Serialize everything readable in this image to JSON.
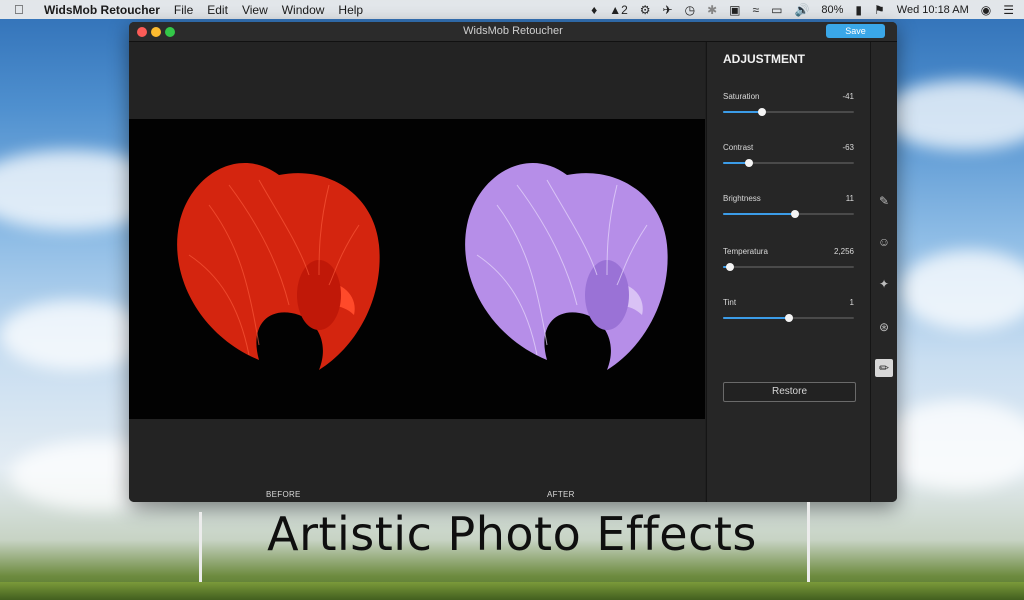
{
  "menubar": {
    "app_name": "WidsMob Retoucher",
    "menus": [
      "File",
      "Edit",
      "View",
      "Window",
      "Help"
    ],
    "status": {
      "badge_count": "2",
      "battery": "80%",
      "datetime": "Wed 10:18 AM"
    }
  },
  "window": {
    "title": "WidsMob Retoucher",
    "save_label": "Save",
    "before_label": "BEFORE",
    "after_label": "AFTER"
  },
  "panel": {
    "title": "ADJUSTMENT",
    "sliders": [
      {
        "name": "Saturation",
        "value": "-41",
        "level": 0.3
      },
      {
        "name": "Contrast",
        "value": "-63",
        "level": 0.2
      },
      {
        "name": "Brightness",
        "value": "11",
        "level": 0.55
      },
      {
        "name": "Temperatura",
        "value": "2,256",
        "level": 0.05
      },
      {
        "name": "Tint",
        "value": "1",
        "level": 0.5
      }
    ],
    "restore_label": "Restore"
  },
  "toolbar": {
    "tools": [
      "brush-icon",
      "face-icon",
      "spray-icon",
      "color-circles-icon",
      "pencil-icon"
    ],
    "active_tool": "pencil-icon"
  },
  "overlay": {
    "caption": "Artistic Photo Effects"
  },
  "colors": {
    "accent": "#3b9ce8",
    "before_fish": "#d4250f",
    "after_fish": "#b68ee8"
  }
}
